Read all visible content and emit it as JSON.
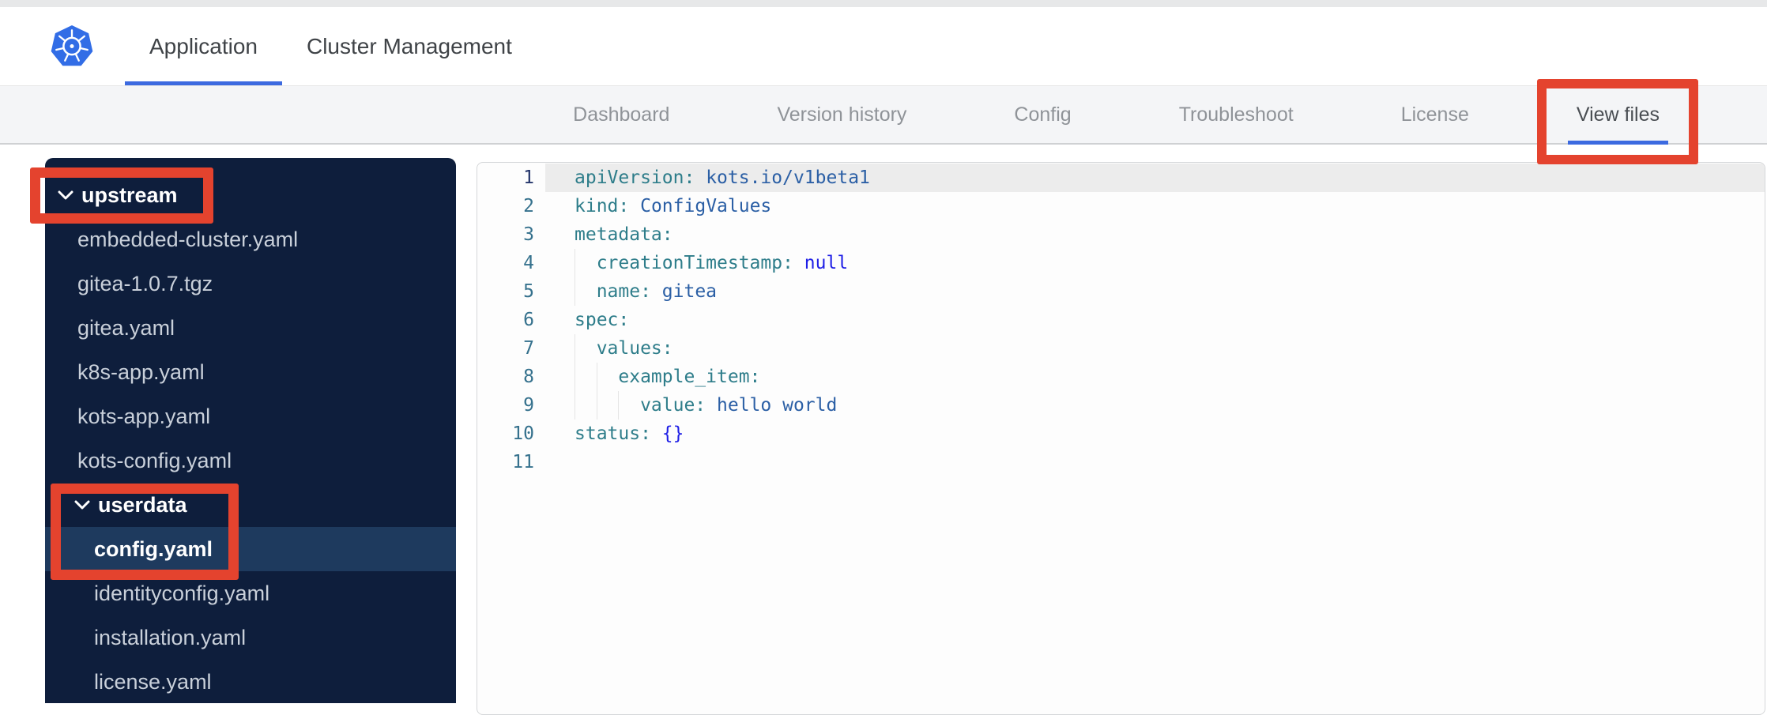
{
  "colors": {
    "annotation_red": "#e4432e",
    "active_tab_blue": "#3c6ae0",
    "sidebar_navy": "#0e1e3c",
    "sidebar_selected_row": "#1e3a5e",
    "kubernetes_blue": "#326de6",
    "code_key_teal": "#2e7d8a",
    "code_value_blue": "#2b5fa5",
    "code_atom_blue": "#1e1ee6"
  },
  "header": {
    "logo": "kubernetes-logo",
    "tabs": [
      {
        "label": "Application",
        "active": true
      },
      {
        "label": "Cluster Management",
        "active": false
      }
    ]
  },
  "subnav": {
    "items": [
      {
        "label": "Dashboard",
        "active": false,
        "annotated": false
      },
      {
        "label": "Version history",
        "active": false,
        "annotated": false
      },
      {
        "label": "Config",
        "active": false,
        "annotated": false
      },
      {
        "label": "Troubleshoot",
        "active": false,
        "annotated": false
      },
      {
        "label": "License",
        "active": false,
        "annotated": false
      },
      {
        "label": "View files",
        "active": true,
        "annotated": true
      }
    ]
  },
  "file_tree": {
    "items": [
      {
        "type": "folder",
        "label": "upstream",
        "depth": 0,
        "expanded": true,
        "selected": false,
        "annotation": "box-upstream"
      },
      {
        "type": "file",
        "label": "embedded-cluster.yaml",
        "depth": 1,
        "selected": false
      },
      {
        "type": "file",
        "label": "gitea-1.0.7.tgz",
        "depth": 1,
        "selected": false
      },
      {
        "type": "file",
        "label": "gitea.yaml",
        "depth": 1,
        "selected": false
      },
      {
        "type": "file",
        "label": "k8s-app.yaml",
        "depth": 1,
        "selected": false
      },
      {
        "type": "file",
        "label": "kots-app.yaml",
        "depth": 1,
        "selected": false
      },
      {
        "type": "file",
        "label": "kots-config.yaml",
        "depth": 1,
        "selected": false
      },
      {
        "type": "folder",
        "label": "userdata",
        "depth": 1,
        "expanded": true,
        "selected": false,
        "annotation": "box-userdata"
      },
      {
        "type": "file",
        "label": "config.yaml",
        "depth": 2,
        "selected": true
      },
      {
        "type": "file",
        "label": "identityconfig.yaml",
        "depth": 2,
        "selected": false
      },
      {
        "type": "file",
        "label": "installation.yaml",
        "depth": 2,
        "selected": false
      },
      {
        "type": "file",
        "label": "license.yaml",
        "depth": 2,
        "selected": false
      }
    ]
  },
  "editor": {
    "filename": "config.yaml",
    "lines": [
      {
        "num": "1",
        "selected": true,
        "indent": 0,
        "tokens": [
          {
            "text": "apiVersion:",
            "type": "key"
          },
          {
            "text": " ",
            "type": "plain"
          },
          {
            "text": "kots.io/v1beta1",
            "type": "value"
          }
        ]
      },
      {
        "num": "2",
        "selected": false,
        "indent": 0,
        "tokens": [
          {
            "text": "kind:",
            "type": "key"
          },
          {
            "text": " ",
            "type": "plain"
          },
          {
            "text": "ConfigValues",
            "type": "value"
          }
        ]
      },
      {
        "num": "3",
        "selected": false,
        "indent": 0,
        "tokens": [
          {
            "text": "metadata:",
            "type": "key"
          }
        ]
      },
      {
        "num": "4",
        "selected": false,
        "indent": 1,
        "tokens": [
          {
            "text": "creationTimestamp:",
            "type": "key"
          },
          {
            "text": " ",
            "type": "plain"
          },
          {
            "text": "null",
            "type": "atom"
          }
        ]
      },
      {
        "num": "5",
        "selected": false,
        "indent": 1,
        "tokens": [
          {
            "text": "name:",
            "type": "key"
          },
          {
            "text": " ",
            "type": "plain"
          },
          {
            "text": "gitea",
            "type": "value"
          }
        ]
      },
      {
        "num": "6",
        "selected": false,
        "indent": 0,
        "tokens": [
          {
            "text": "spec:",
            "type": "key"
          }
        ]
      },
      {
        "num": "7",
        "selected": false,
        "indent": 1,
        "tokens": [
          {
            "text": "values:",
            "type": "key"
          }
        ]
      },
      {
        "num": "8",
        "selected": false,
        "indent": 2,
        "tokens": [
          {
            "text": "example_item:",
            "type": "key"
          }
        ]
      },
      {
        "num": "9",
        "selected": false,
        "indent": 3,
        "tokens": [
          {
            "text": "value:",
            "type": "key"
          },
          {
            "text": " ",
            "type": "plain"
          },
          {
            "text": "hello world",
            "type": "value"
          }
        ]
      },
      {
        "num": "10",
        "selected": false,
        "indent": 0,
        "tokens": [
          {
            "text": "status:",
            "type": "key"
          },
          {
            "text": " ",
            "type": "plain"
          },
          {
            "text": "{}",
            "type": "atom"
          }
        ]
      },
      {
        "num": "11",
        "selected": false,
        "indent": 0,
        "tokens": []
      }
    ]
  }
}
